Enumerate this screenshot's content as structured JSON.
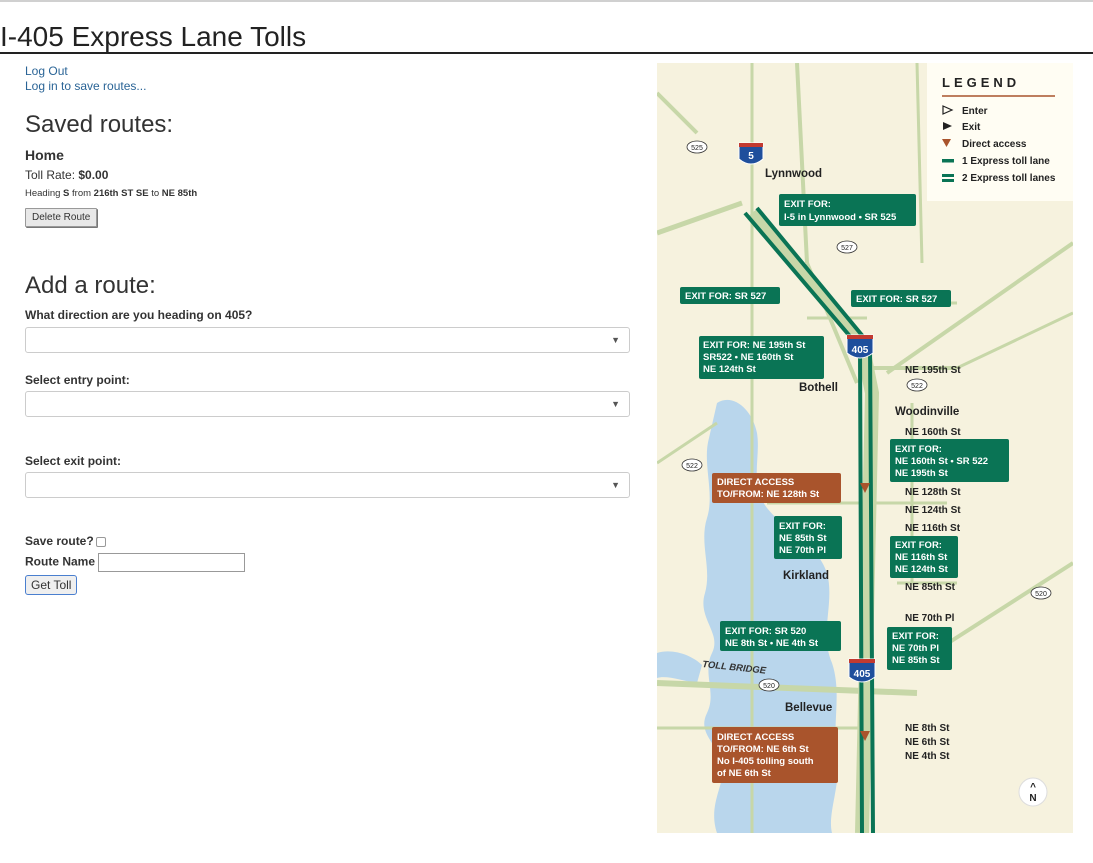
{
  "page": {
    "title": "I-405 Express Lane Tolls"
  },
  "auth": {
    "logout": "Log Out",
    "login_save": "Log in to save routes..."
  },
  "saved": {
    "heading": "Saved routes:",
    "route": {
      "name": "Home",
      "toll_label": "Toll Rate:",
      "toll_value": "$0.00",
      "heading_word": "Heading",
      "direction": "S",
      "from_word": "from",
      "from": "216th ST SE",
      "to_word": "to",
      "to": "NE 85th",
      "delete_label": "Delete Route"
    }
  },
  "add": {
    "heading": "Add a route:",
    "direction_label": "What direction are you heading on 405?",
    "entry_label": "Select entry point:",
    "exit_label": "Select exit point:",
    "save_label": "Save route?",
    "route_name_label": "Route Name",
    "route_name_value": "",
    "submit_label": "Get Toll"
  },
  "map": {
    "legend": {
      "title": "LEGEND",
      "items": [
        "Enter",
        "Exit",
        "Direct access",
        "1 Express toll lane",
        "2 Express toll lanes"
      ]
    },
    "shields": {
      "i5": "5",
      "i405_top": "405",
      "i405_bottom": "405"
    },
    "state_routes": {
      "sr525": "525",
      "sr527": "527",
      "sr522_a": "522",
      "sr522_b": "522",
      "sr520_a": "520",
      "sr520_b": "520"
    },
    "cities": [
      "Lynnwood",
      "Bothell",
      "Woodinville",
      "Kirkland",
      "Bellevue"
    ],
    "toll_bridge": "TOLL BRIDGE",
    "street_labels": [
      "NE 195th St",
      "NE 160th St",
      "NE 128th St",
      "NE 124th St",
      "NE 116th St",
      "NE 85th St",
      "NE 70th Pl",
      "NE 8th St",
      "NE 6th St",
      "NE 4th St"
    ],
    "callouts": {
      "exit_i5": [
        "EXIT FOR:",
        "I-5 in Lynnwood • SR 525"
      ],
      "exit_sr527_left": [
        "EXIT FOR: SR 527"
      ],
      "exit_sr527_right": [
        "EXIT FOR: SR 527"
      ],
      "exit_ne195": [
        "EXIT FOR: NE 195th St",
        "SR522 • NE 160th St",
        "NE 124th St"
      ],
      "exit_ne160": [
        "EXIT FOR:",
        "NE 160th St • SR 522",
        "NE 195th St"
      ],
      "direct_128": [
        "DIRECT ACCESS",
        "TO/FROM: NE 128th St"
      ],
      "exit_ne85": [
        "EXIT FOR:",
        "NE 85th St",
        "NE 70th Pl"
      ],
      "exit_ne116": [
        "EXIT FOR:",
        "NE 116th St",
        "NE 124th St"
      ],
      "exit_sr520": [
        "EXIT FOR: SR 520",
        "NE 8th St • NE 4th St"
      ],
      "exit_ne70": [
        "EXIT FOR:",
        "NE 70th Pl",
        "NE 85th St"
      ],
      "direct_6th": [
        "DIRECT ACCESS",
        "TO/FROM: NE 6th St",
        "No I-405 tolling south",
        "of NE 6th St"
      ]
    },
    "north_label": "N",
    "colors": {
      "toll_green": "#0a7455",
      "direct_brown": "#a9542c",
      "land": "#f6f2de",
      "water": "#b9d6ec",
      "road": "#c7d7a8"
    }
  }
}
